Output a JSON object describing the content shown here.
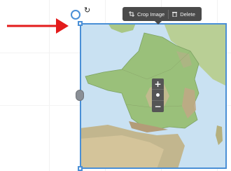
{
  "toolbar": {
    "crop_label": "Crop Image",
    "delete_label": "Delete",
    "crop_icon": "crop-icon",
    "delete_icon": "trash-icon"
  },
  "zoom": {
    "zoom_in_label": "+",
    "zoom_out_label": "−",
    "center_icon": "dot-icon"
  },
  "rotate_icon_glyph": "↻",
  "colors": {
    "selection": "#4a8fd6",
    "toolbar_bg": "#4a4a4a",
    "annotation_arrow": "#e31b1b",
    "sea": "#c9e1f2",
    "lowland": "#9ac07a",
    "highland": "#c8b892"
  }
}
